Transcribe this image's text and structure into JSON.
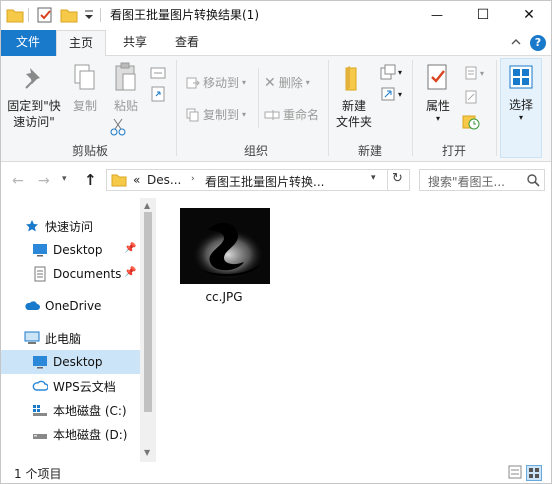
{
  "window": {
    "title": "看图王批量图片转换结果(1)",
    "controls": {
      "minimize": "—",
      "maximize": "☐",
      "close": "✕"
    }
  },
  "tabs": {
    "file": "文件",
    "home": "主页",
    "share": "共享",
    "view": "查看"
  },
  "ribbon": {
    "clipboard": {
      "pin_line1": "固定到\"快",
      "pin_line2": "速访问\"",
      "copy": "复制",
      "paste": "粘贴",
      "group": "剪贴板"
    },
    "organize": {
      "move_to": "移动到",
      "copy_to": "复制到",
      "delete": "删除",
      "rename": "重命名",
      "group": "组织"
    },
    "new": {
      "new_folder_line1": "新建",
      "new_folder_line2": "文件夹",
      "group": "新建"
    },
    "open": {
      "properties": "属性",
      "group": "打开"
    },
    "select": {
      "label": "选择"
    }
  },
  "address": {
    "crumbs": [
      "«",
      "Des...",
      "看图王批量图片转换..."
    ],
    "search_placeholder": "搜索\"看图王..."
  },
  "nav": {
    "quick_access": "快速访问",
    "desktop_pinned": "Desktop",
    "documents_pinned": "Documents",
    "onedrive": "OneDrive",
    "this_pc": "此电脑",
    "desktop": "Desktop",
    "wps_cloud": "WPS云文档",
    "disk_c": "本地磁盘 (C:)",
    "disk_d": "本地磁盘 (D:)"
  },
  "files": [
    {
      "name": "cc.JPG"
    }
  ],
  "status": {
    "count": "1 个项目"
  },
  "colors": {
    "accent": "#1979ca",
    "selection": "#cce4f7",
    "folder": "#f7c948"
  }
}
